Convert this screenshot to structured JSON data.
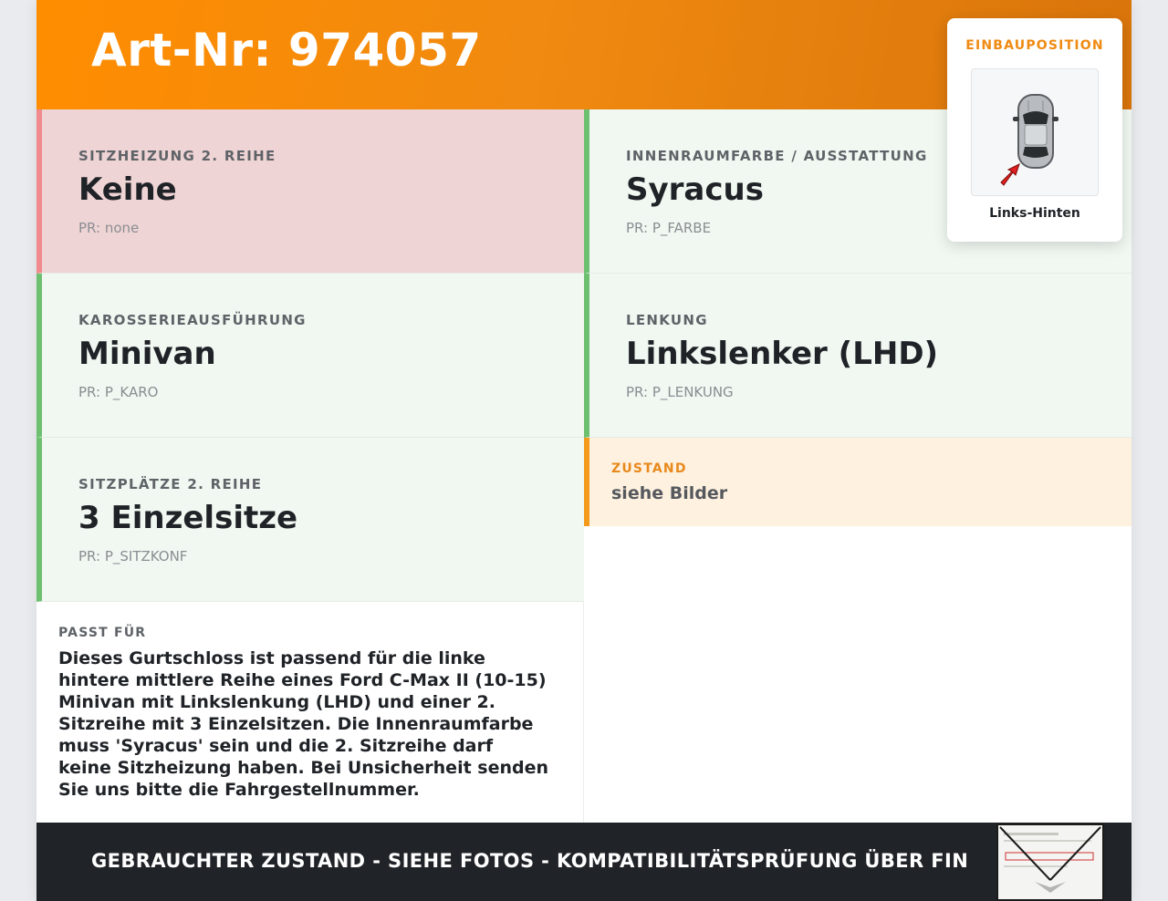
{
  "header": {
    "art_nr": "Art-Nr: 974057"
  },
  "einbauposition": {
    "title": "EINBAUPOSITION",
    "label": "Links-Hinten"
  },
  "specs": [
    {
      "label": "SITZHEIZUNG 2. REIHE",
      "value": "Keine",
      "pr": "PR: none",
      "status": "mismatch"
    },
    {
      "label": "INNENRAUMFARBE / AUSSTATTUNG",
      "value": "Syracus",
      "pr": "PR: P_FARBE",
      "status": "match"
    },
    {
      "label": "KAROSSERIEAUSFÜHRUNG",
      "value": "Minivan",
      "pr": "PR: P_KARO",
      "status": "match"
    },
    {
      "label": "LENKUNG",
      "value": "Linkslenker (LHD)",
      "pr": "PR: P_LENKUNG",
      "status": "match"
    },
    {
      "label": "SITZPLÄTZE 2. REIHE",
      "value": "3 Einzelsitze",
      "pr": "PR: P_SITZKONF",
      "status": "match"
    }
  ],
  "zustand": {
    "label": "ZUSTAND",
    "value": "siehe Bilder"
  },
  "passt_fuer": {
    "label": "PASST FÜR",
    "text": "Dieses Gurtschloss ist passend für die linke hintere mittlere Reihe eines Ford C-Max II (10-15) Minivan mit Linkslenkung (LHD) und einer 2. Sitzreihe mit 3 Einzelsitzen. Die Innenraumfarbe muss 'Syracus' sein und die 2. Sitzreihe darf keine Sitzheizung haben. Bei Unsicherheit senden Sie uns bitte die Fahrgestellnummer."
  },
  "footer": {
    "text": "GEBRAUCHTER ZUSTAND - SIEHE FOTOS - KOMPATIBILITÄTSPRÜFUNG ÜBER FIN"
  },
  "colors": {
    "accent": "#ff8d00",
    "match_border": "#6cc070",
    "mismatch_border": "#ef8a8d",
    "footer_bg": "#202327"
  }
}
